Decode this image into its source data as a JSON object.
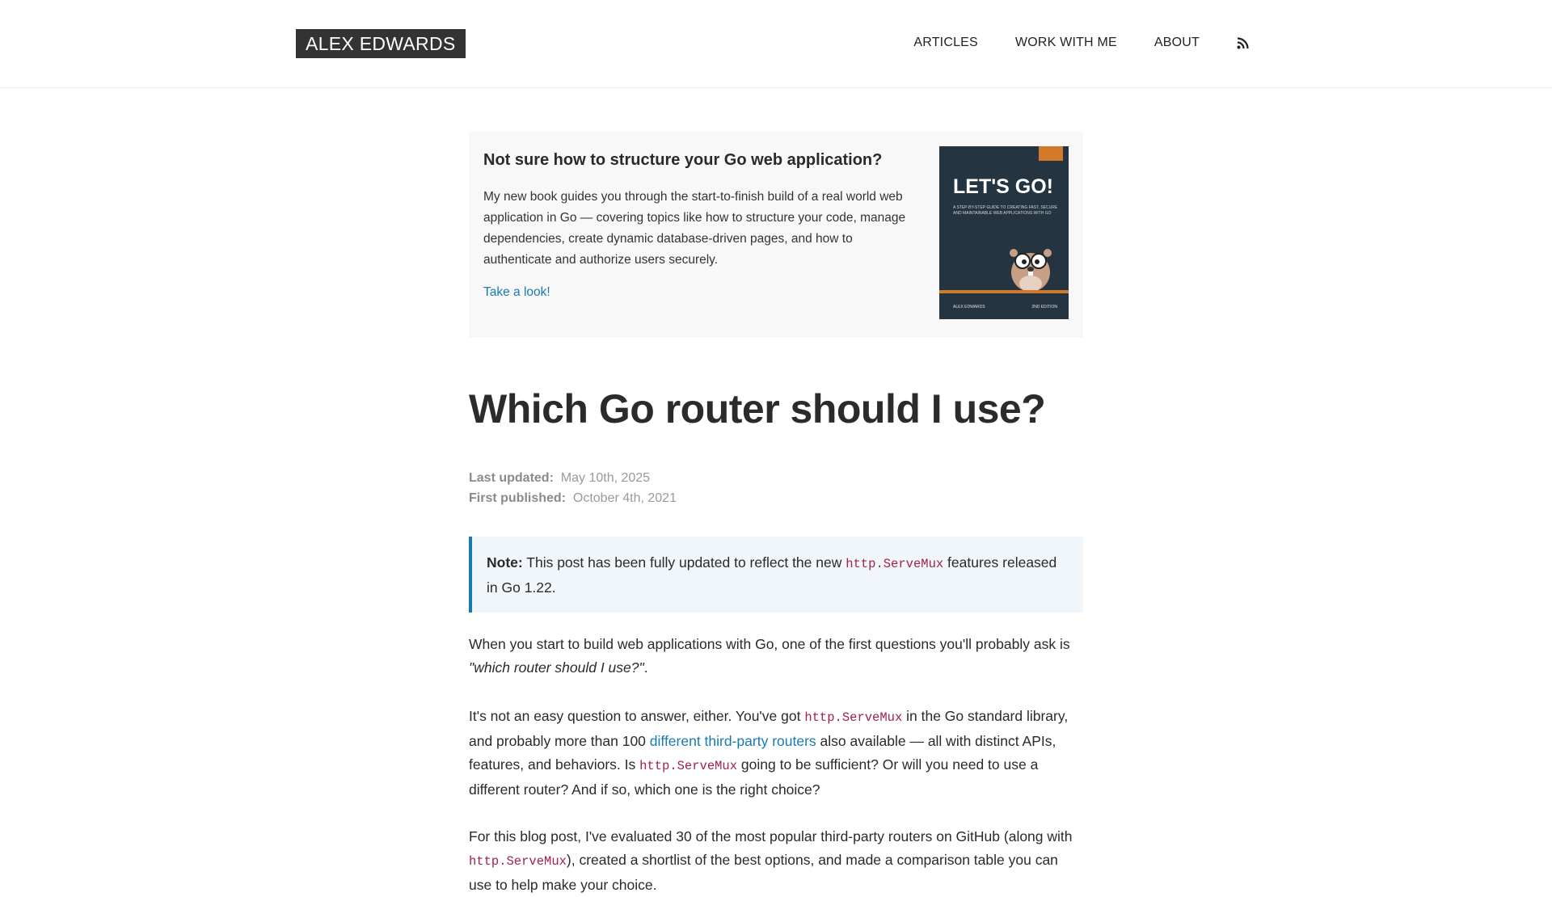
{
  "header": {
    "logo": "ALEX EDWARDS",
    "nav": [
      "ARTICLES",
      "WORK WITH ME",
      "ABOUT"
    ],
    "rss_icon": "rss-icon"
  },
  "promo": {
    "title": "Not sure how to structure your Go web application?",
    "body": "My new book guides you through the start-to-finish build of a real world web application in Go — covering topics like how to structure your code, manage dependencies, create dynamic database-driven pages, and how to authenticate and authorize users securely.",
    "link": "Take a look!",
    "book": {
      "tag": "Let's Go!",
      "title": "LET'S GO!",
      "subtitle": "A STEP-BY-STEP GUIDE TO CREATING FAST, SECURE AND MAINTAINABLE WEB APPLICATIONS WITH GO",
      "author": "ALEX EDWARDS",
      "edition": "2ND EDITION"
    }
  },
  "article": {
    "title": "Which Go router should I use?",
    "last_updated_label": "Last updated:",
    "last_updated": "May 10th, 2025",
    "first_published_label": "First published:",
    "first_published": "October 4th, 2021",
    "note_label": "Note:",
    "note_before": "This post has been fully updated to reflect the new",
    "note_code": "http.ServeMux",
    "note_after": "features released in Go 1.22.",
    "p1_before": "When you start to build web applications with Go, one of the first questions you'll probably ask is",
    "p1_quote": "\"which router should I use?\"",
    "p1_after": ".",
    "p2_a": "It's not an easy question to answer, either. You've got",
    "p2_code1": "http.ServeMux",
    "p2_b": "in the Go standard library, and probably more than 100",
    "p2_link": "different third-party routers",
    "p2_c": "also available — all with distinct APIs, features, and behaviors. Is",
    "p2_code2": "http.ServeMux",
    "p2_d": "going to be sufficient? Or will you need to use a different router? And if so, which one is the right choice?",
    "p3_a": "For this blog post, I've evaluated 30 of the most popular third-party routers on GitHub (along with",
    "p3_code": "http.ServeMux",
    "p3_b": "), created a shortlist of the best options, and made a comparison table you can use to help make your choice."
  }
}
